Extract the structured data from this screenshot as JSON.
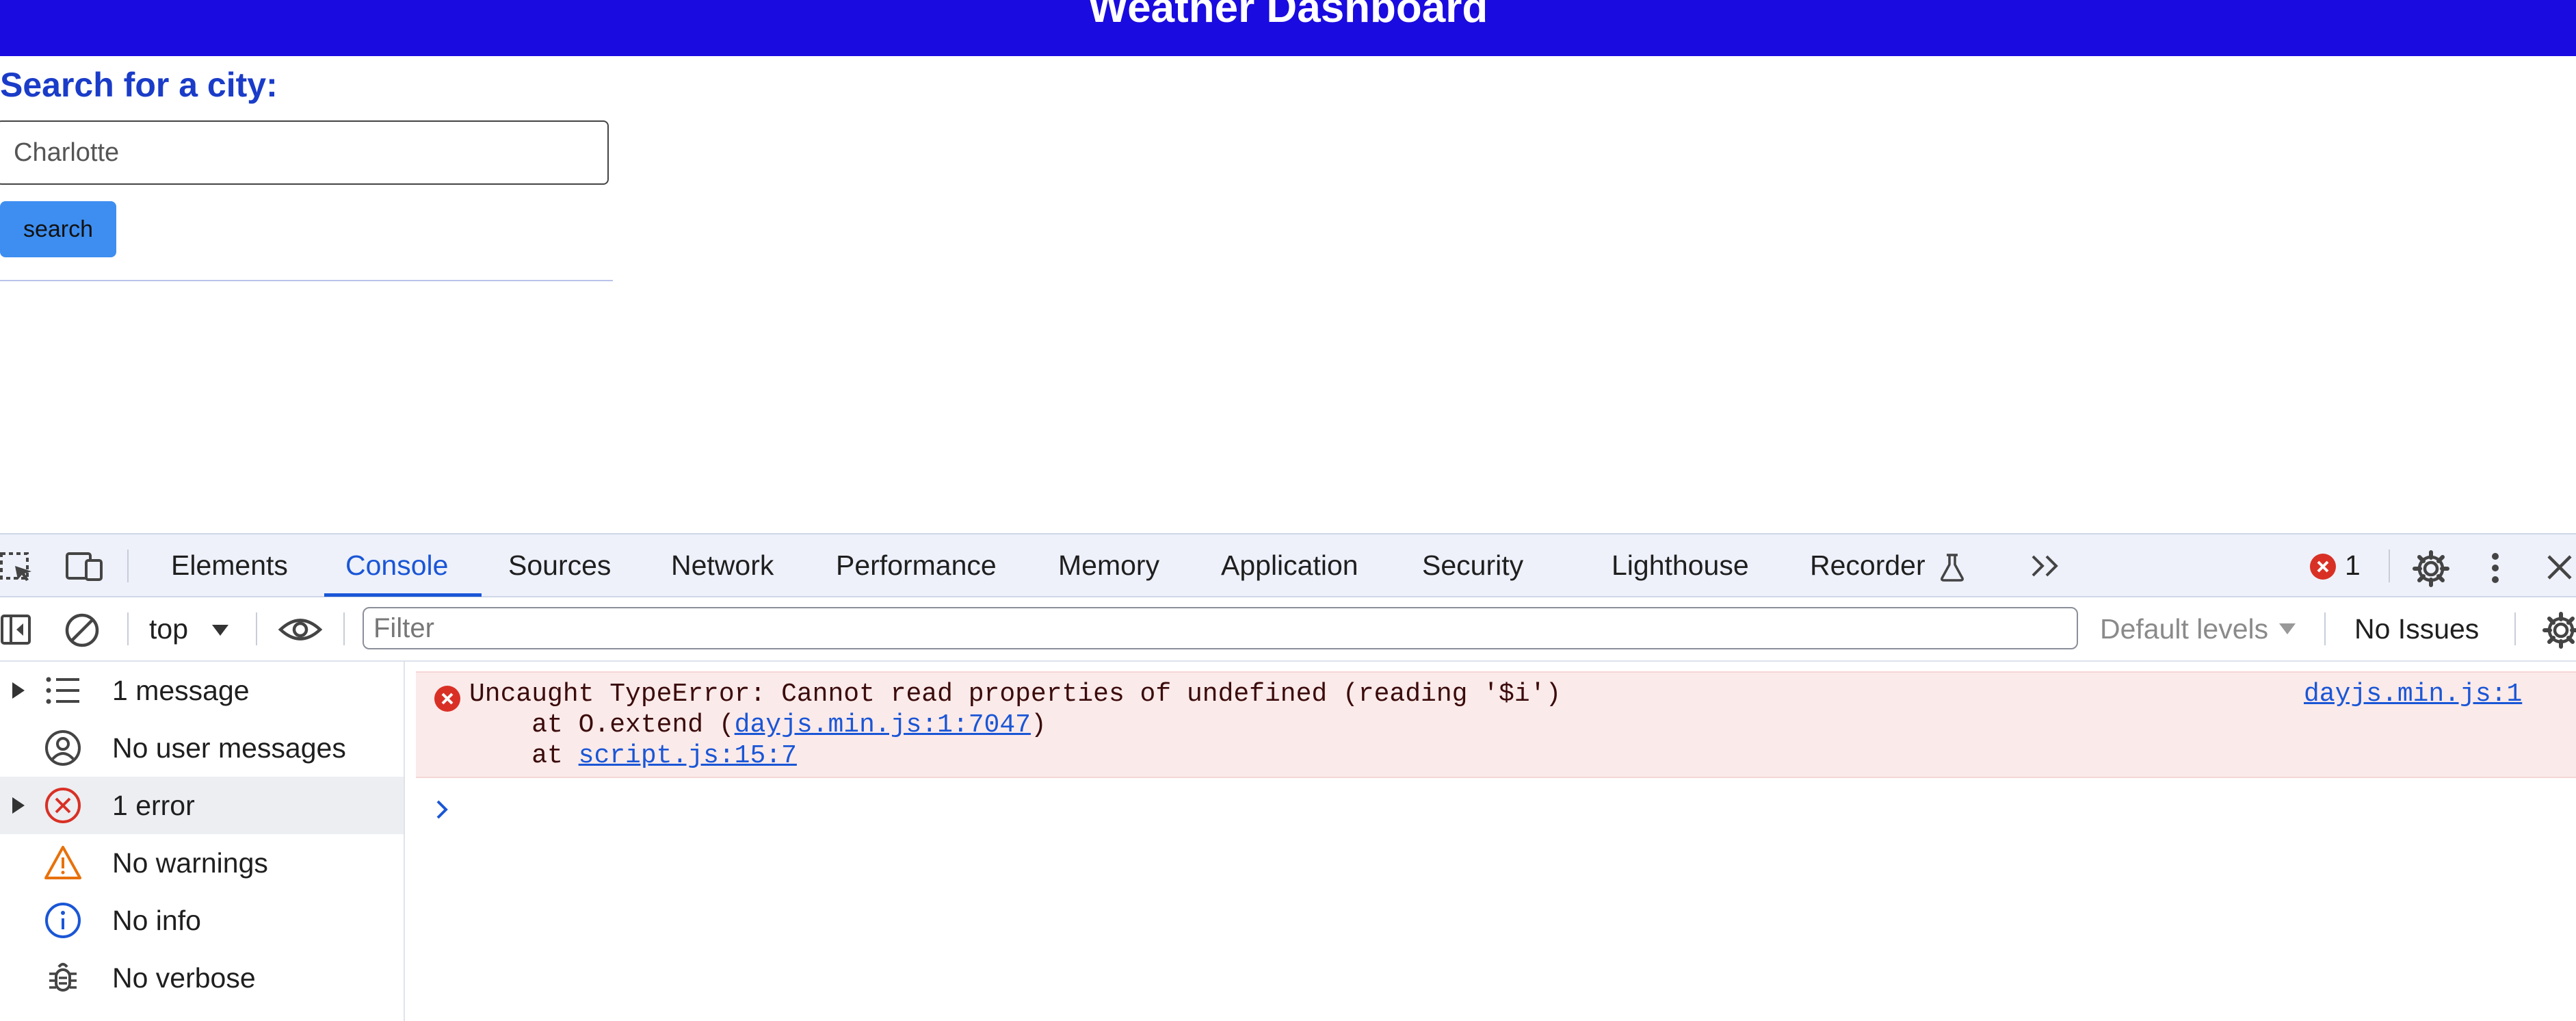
{
  "page": {
    "title": "Weather Dashboard",
    "search_label": "Search for a city:",
    "city_value": "Charlotte",
    "search_button": "search"
  },
  "devtools": {
    "tabs": [
      "Elements",
      "Console",
      "Sources",
      "Network",
      "Performance",
      "Memory",
      "Application",
      "Security",
      "Lighthouse",
      "Recorder"
    ],
    "active_tab": "Console",
    "error_count": "1",
    "toolbar": {
      "context": "top",
      "filter_placeholder": "Filter",
      "levels": "Default levels",
      "issues": "No Issues"
    },
    "sidebar": {
      "items": [
        {
          "label": "1 message",
          "icon": "list-icon"
        },
        {
          "label": "No user messages",
          "icon": "user-icon"
        },
        {
          "label": "1 error",
          "icon": "error-icon"
        },
        {
          "label": "No warnings",
          "icon": "warning-icon"
        },
        {
          "label": "No info",
          "icon": "info-icon"
        },
        {
          "label": "No verbose",
          "icon": "bug-icon"
        }
      ]
    },
    "console": {
      "error_text": "Uncaught TypeError: Cannot read properties of undefined (reading '$i')",
      "stack_line1_prefix": "    at O.extend (",
      "stack_line1_link": "dayjs.min.js:1:7047",
      "stack_line1_suffix": ")",
      "stack_line2_prefix": "    at ",
      "stack_line2_link": "script.js:15:7",
      "source_link": "dayjs.min.js:1"
    }
  },
  "colors": {
    "header_bg": "#1a0be0",
    "accent_blue": "#1a56d6",
    "button_blue": "#3d8ef0",
    "error_red": "#d93025",
    "error_bg": "#fbeaea"
  }
}
